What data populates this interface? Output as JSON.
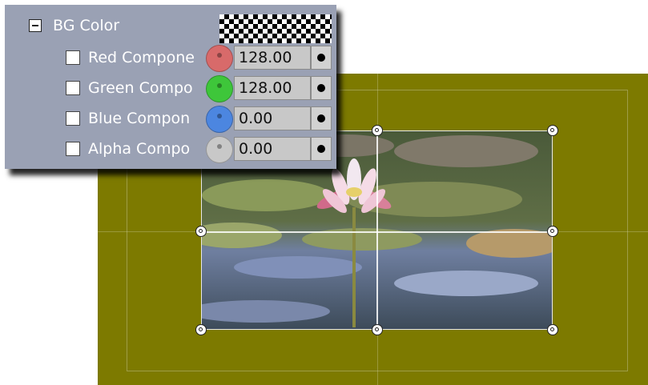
{
  "panel": {
    "header_label": "BG Color",
    "properties": [
      {
        "label": "Red Compone",
        "value": "128.00",
        "swatch_color": "#d86a6a",
        "icon": "red-swatch-icon"
      },
      {
        "label": "Green Compo",
        "value": "128.00",
        "swatch_color": "#3ec63a",
        "icon": "green-swatch-icon"
      },
      {
        "label": "Blue Compon",
        "value": "0.00",
        "swatch_color": "#4c86e0",
        "icon": "blue-swatch-icon"
      },
      {
        "label": "Alpha Compo",
        "value": "0.00",
        "swatch_color": "#c8c8c8",
        "icon": "alpha-swatch-icon"
      }
    ]
  },
  "canvas": {
    "background_color": "#7d7a00"
  }
}
